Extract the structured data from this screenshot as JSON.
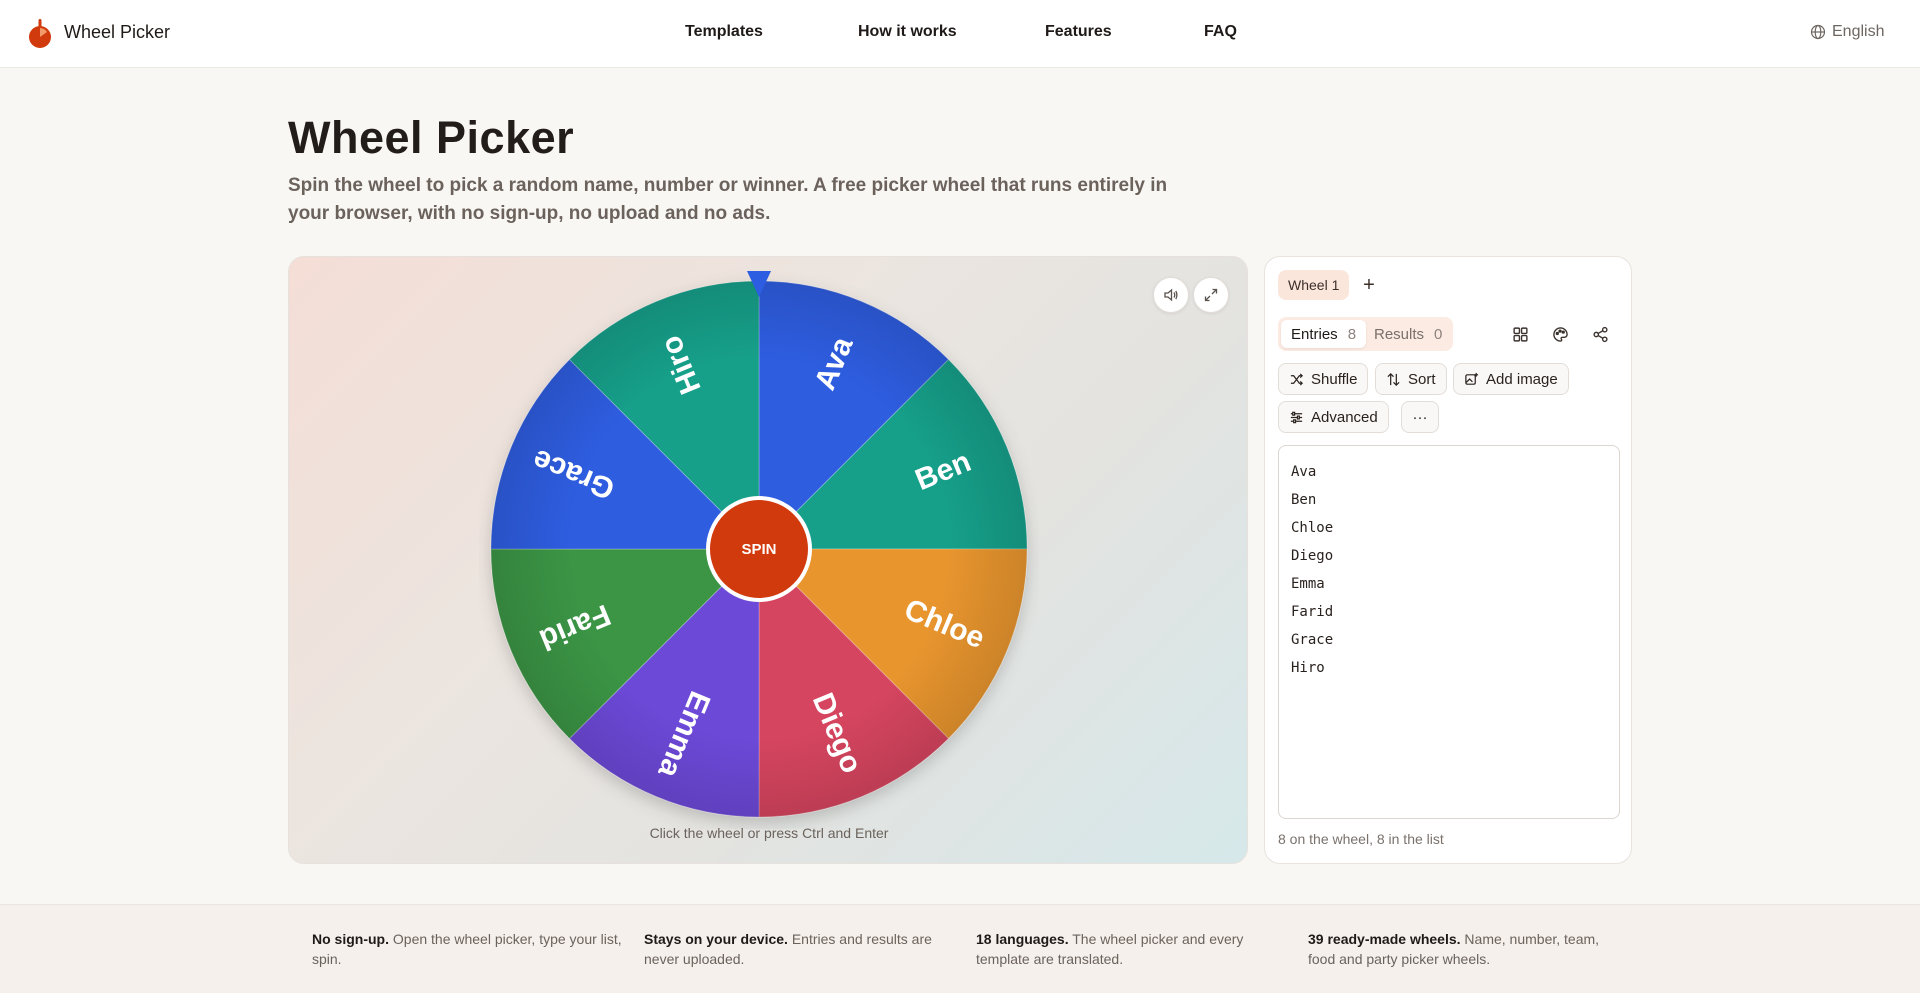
{
  "header": {
    "brand": "Wheel Picker",
    "nav": [
      "Templates",
      "How it works",
      "Features",
      "FAQ"
    ],
    "language": "English"
  },
  "hero": {
    "title": "Wheel Picker",
    "subtitle": "Spin the wheel to pick a random name, number or winner. A free picker wheel that runs entirely in your browser, with no sign-up, no upload and no ads."
  },
  "wheel": {
    "spin_label": "SPIN",
    "hint": "Click the wheel or press Ctrl and Enter",
    "segments": [
      {
        "label": "Ava",
        "color": "#2d5de0"
      },
      {
        "label": "Ben",
        "color": "#12a08a"
      },
      {
        "label": "Chloe",
        "color": "#e8952f"
      },
      {
        "label": "Diego",
        "color": "#d6455e"
      },
      {
        "label": "Emma",
        "color": "#6d49d8"
      },
      {
        "label": "Farid",
        "color": "#3a9544"
      },
      {
        "label": "Grace",
        "color": "#2d5de0"
      },
      {
        "label": "Hiro",
        "color": "#12a08a"
      }
    ],
    "pointer_color": "#2d5de0",
    "spin_color": "#d13a0c"
  },
  "panel": {
    "wheel_tab": "Wheel 1",
    "add_tab": "+",
    "entries_tab": {
      "label": "Entries",
      "count": "8"
    },
    "results_tab": {
      "label": "Results",
      "count": "0"
    },
    "tools": {
      "shuffle": "Shuffle",
      "sort": "Sort",
      "add_image": "Add image",
      "advanced": "Advanced",
      "more": "···"
    },
    "entries": [
      "Ava",
      "Ben",
      "Chloe",
      "Diego",
      "Emma",
      "Farid",
      "Grace",
      "Hiro"
    ],
    "count_note": "8 on the wheel, 8 in the list"
  },
  "footer": {
    "features": [
      {
        "bold": "No sign-up.",
        "text": " Open the wheel picker, type your list, spin."
      },
      {
        "bold": "Stays on your device.",
        "text": " Entries and results are never uploaded."
      },
      {
        "bold": "18 languages.",
        "text": " The wheel picker and every template are translated."
      },
      {
        "bold": "39 ready-made wheels.",
        "text": " Name, number, team, food and party picker wheels."
      }
    ]
  },
  "colors": {
    "accent": "#d13a0c",
    "tab_bg": "#fbe6dc"
  }
}
